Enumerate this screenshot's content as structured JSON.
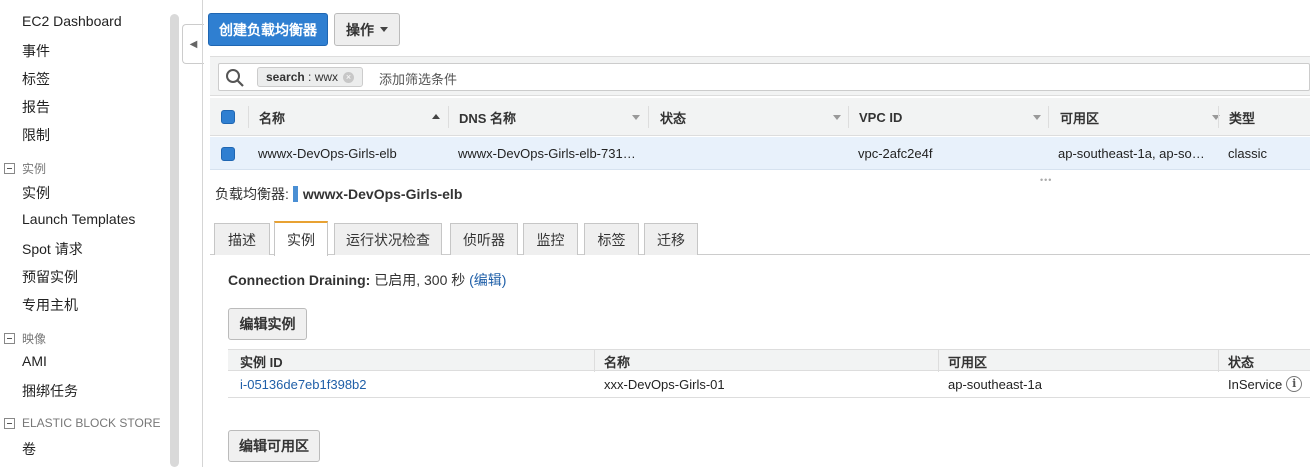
{
  "sidebar": {
    "items_top": [
      "EC2 Dashboard",
      "事件",
      "标签",
      "报告",
      "限制"
    ],
    "section_instances": "实例",
    "items_instances": [
      "实例",
      "Launch Templates",
      "Spot 请求",
      "预留实例",
      "专用主机"
    ],
    "section_images": "映像",
    "items_images": [
      "AMI",
      "捆绑任务"
    ],
    "section_ebs": "ELASTIC BLOCK STORE",
    "items_ebs": [
      "卷"
    ]
  },
  "toolbar": {
    "create_label": "创建负载均衡器",
    "actions_label": "操作"
  },
  "search": {
    "token_key": "search",
    "token_sep": " : ",
    "token_value": "wwx",
    "placeholder": "添加筛选条件"
  },
  "table": {
    "columns": [
      "名称",
      "DNS 名称",
      "状态",
      "VPC ID",
      "可用区",
      "类型"
    ],
    "row": {
      "name": "wwwx-DevOps-Girls-elb",
      "dns": "wwwx-DevOps-Girls-elb-731…",
      "status": "",
      "vpc": "vpc-2afc2e4f",
      "az": "ap-southeast-1a, ap-so…",
      "type": "classic"
    }
  },
  "detail": {
    "label": "负载均衡器:",
    "name": "wwwx-DevOps-Girls-elb",
    "tabs": [
      "描述",
      "实例",
      "运行状况检查",
      "侦听器",
      "监控",
      "标签",
      "迁移"
    ],
    "active_tab": "实例",
    "draining_label": "Connection Draining:",
    "draining_value": "已启用, 300 秒",
    "draining_edit": "(编辑)",
    "edit_instances_label": "编辑实例",
    "edit_az_label": "编辑可用区",
    "instance_columns": [
      "实例 ID",
      "名称",
      "可用区",
      "状态"
    ],
    "instances": [
      {
        "id": "i-05136de7eb1f398b2",
        "name": "xxx-DevOps-Girls-01",
        "az": "ap-southeast-1a",
        "state": "InService"
      }
    ]
  },
  "colors": {
    "primary": "#2f7fd1",
    "link": "#1f5fa8",
    "active_tab_accent": "#e8a233",
    "selected_row": "#e8f1fb"
  }
}
